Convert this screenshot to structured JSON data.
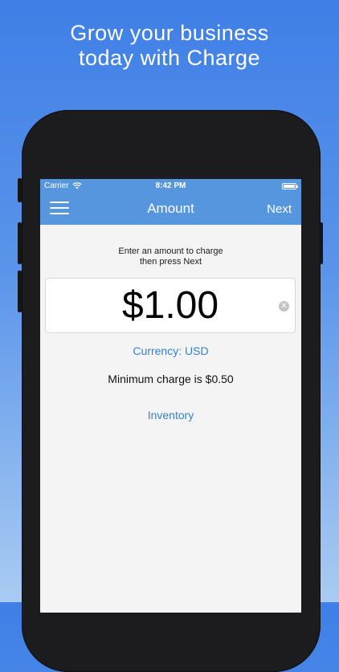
{
  "headline": {
    "line1": "Grow your business",
    "line2": "today with Charge"
  },
  "status_bar": {
    "carrier": "Carrier",
    "time": "8:42 PM",
    "icons": [
      "wifi-icon",
      "battery-icon"
    ]
  },
  "nav": {
    "menu_icon": "hamburger-menu-icon",
    "title": "Amount",
    "next_label": "Next"
  },
  "main": {
    "instruction_line1": "Enter an amount to charge",
    "instruction_line2": "then press Next",
    "amount": "$1.00",
    "clear_icon": "clear-x-icon",
    "currency_label": "Currency: USD",
    "minimum_text": "Minimum charge is $0.50",
    "inventory_label": "Inventory"
  },
  "colors": {
    "background_top": "#3f7fe6",
    "nav_bar": "#5596de",
    "link": "#2e82d8",
    "screen_bg": "#f4f4f4"
  }
}
